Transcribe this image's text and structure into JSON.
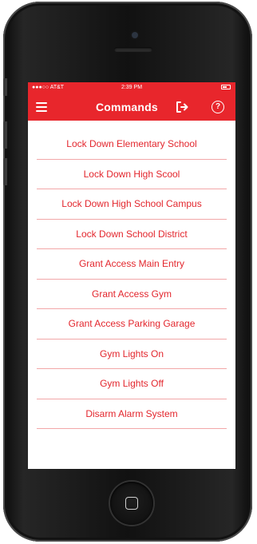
{
  "status_bar": {
    "carrier": "●●●○○ AT&T",
    "time": "2:39 PM"
  },
  "header": {
    "title": "Commands",
    "menu_icon": "hamburger-menu-icon",
    "exit_icon": "sign-out-icon",
    "help_icon": "help-circle-icon",
    "help_glyph": "?"
  },
  "commands": [
    "Lock Down Elementary School",
    "Lock Down High Scool",
    "Lock Down High School Campus",
    "Lock Down School District",
    "Grant Access Main Entry",
    "Grant Access Gym",
    "Grant Access Parking Garage",
    "Gym Lights On",
    "Gym Lights Off",
    "Disarm Alarm System"
  ],
  "colors": {
    "accent": "#e8262c",
    "divider": "#f2a7a8",
    "item_text": "#e3262d"
  }
}
